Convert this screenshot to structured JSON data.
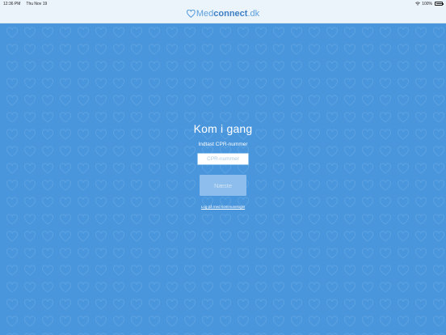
{
  "status_bar": {
    "time": "12:36 PM",
    "date": "Thu Nov 19",
    "battery_text": "100%",
    "wifi_icon": "wifi-icon",
    "battery_icon": "battery-icon"
  },
  "header": {
    "logo_light": "Med",
    "logo_bold": "connect",
    "logo_suffix": ".dk",
    "logo_icon": "heart-icon"
  },
  "main": {
    "title": "Kom i gang",
    "subtitle": "Indtast CPR-nummer",
    "cpr_placeholder": "CPR-nummer",
    "cpr_value": "",
    "next_label": "Næste",
    "login_link": "Log på med kommunelogin"
  },
  "colors": {
    "background": "#4a96dc",
    "header": "#ecf4fb",
    "brand": "#5b9fdc",
    "button_disabled": "#8cbdec"
  }
}
